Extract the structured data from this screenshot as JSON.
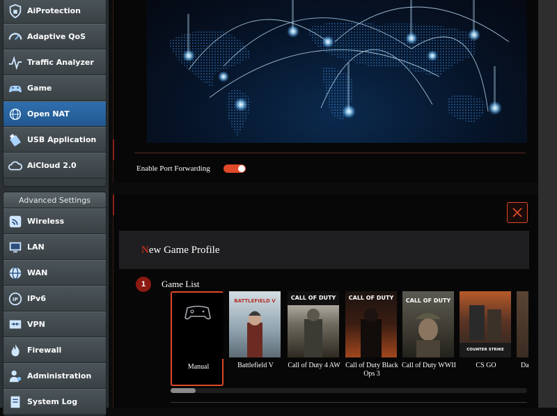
{
  "sidebar": {
    "top_items": [
      {
        "label": "AiProtection",
        "icon": "shield-icon"
      },
      {
        "label": "Adaptive QoS",
        "icon": "speedometer-icon"
      },
      {
        "label": "Traffic Analyzer",
        "icon": "pulse-icon"
      },
      {
        "label": "Game",
        "icon": "gamepad-icon"
      },
      {
        "label": "Open NAT",
        "icon": "globe-network-icon",
        "active": true
      },
      {
        "label": "USB Application",
        "icon": "usb-icon"
      },
      {
        "label": "AiCloud 2.0",
        "icon": "cloud-icon"
      }
    ],
    "advanced_header": "Advanced Settings",
    "advanced_items": [
      {
        "label": "Wireless",
        "icon": "wifi-icon"
      },
      {
        "label": "LAN",
        "icon": "monitor-icon"
      },
      {
        "label": "WAN",
        "icon": "globe-icon"
      },
      {
        "label": "IPv6",
        "icon": "ipv6-icon"
      },
      {
        "label": "VPN",
        "icon": "vpn-icon"
      },
      {
        "label": "Firewall",
        "icon": "fire-icon"
      },
      {
        "label": "Administration",
        "icon": "person-gear-icon"
      },
      {
        "label": "System Log",
        "icon": "log-icon"
      }
    ]
  },
  "port_forwarding": {
    "label": "Enable Port Forwarding",
    "enabled": true
  },
  "dialog": {
    "title_first": "N",
    "title_rest": "ew Game Profile",
    "step_number": "1",
    "section_label": "Game List",
    "games": [
      {
        "name": "Manual",
        "selected": true
      },
      {
        "name": "Battlefield V",
        "cover_text": "BATTLEFIELD V"
      },
      {
        "name": "Call of Duty 4 AW",
        "cover_text": "CALL OF DUTY"
      },
      {
        "name": "Call of Duty Black Ops 3",
        "cover_text": "CALL OF DUTY"
      },
      {
        "name": "Call of Duty WWII",
        "cover_text": "CALL OF DUTY"
      },
      {
        "name": "CS GO",
        "cover_text": "COUNTER STRIKE"
      },
      {
        "name": "Da"
      }
    ]
  },
  "colors": {
    "accent": "#e0492a",
    "active_menu": "#2f6fae",
    "panel_bg": "#070707",
    "title_bar": "#1f1f21"
  }
}
